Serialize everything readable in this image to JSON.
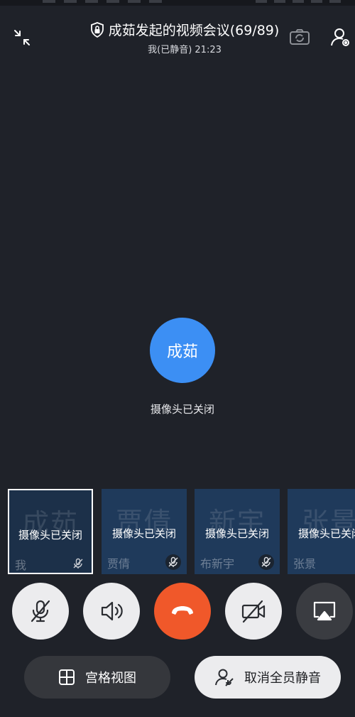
{
  "header": {
    "title": "成茹发起的视频会议(69/89)",
    "subtitle": "我(已静音) 21:23"
  },
  "main": {
    "host_avatar_text": "成茹",
    "camera_off_text": "摄像头已关闭"
  },
  "participants": [
    {
      "bg_name": "成茹",
      "camera_label": "摄像头已关闭",
      "name": "我",
      "muted": true,
      "selected": true
    },
    {
      "bg_name": "贾倩",
      "camera_label": "摄像头已关闭",
      "name": "贾倩",
      "muted": true,
      "selected": false
    },
    {
      "bg_name": "新宇",
      "camera_label": "摄像头已关闭",
      "name": "布新宇",
      "muted": true,
      "selected": false
    },
    {
      "bg_name": "张景",
      "camera_label": "摄像头已关闭",
      "name": "张景",
      "muted": false,
      "selected": false
    }
  ],
  "controls": {
    "icons": [
      "mic-muted-icon",
      "speaker-icon",
      "hang-up-icon",
      "camera-off-icon",
      "screen-share-icon"
    ]
  },
  "bottom": {
    "grid_view_label": "宫格视图",
    "unmute_all_label": "取消全员静音"
  },
  "colors": {
    "background": "#1f2229",
    "avatar": "#3c8ff4",
    "end_call": "#f0582a",
    "tile": "#1f3a5b"
  }
}
